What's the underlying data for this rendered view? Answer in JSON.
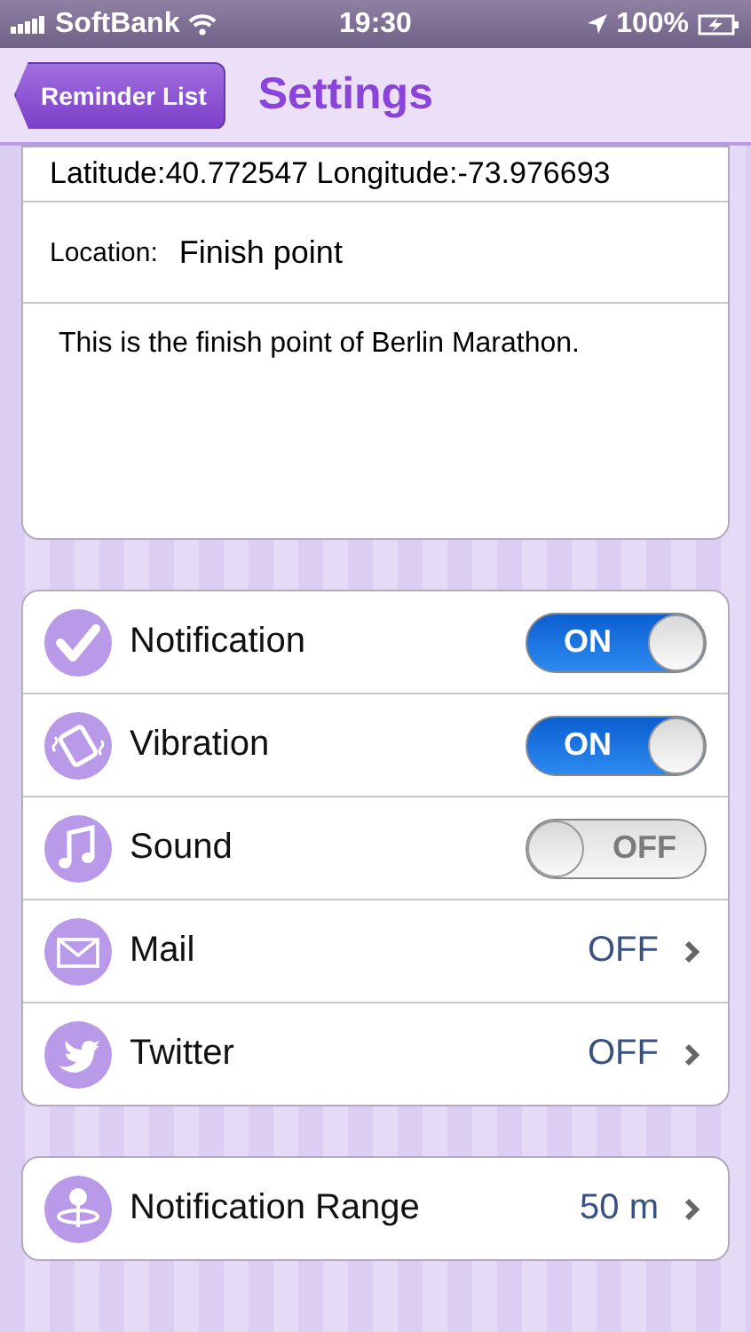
{
  "status_bar": {
    "carrier": "SoftBank",
    "time": "19:30",
    "battery": "100%"
  },
  "nav": {
    "back": "Reminder List",
    "title": "Settings"
  },
  "location_card": {
    "coordinates": "Latitude:40.772547 Longitude:-73.976693",
    "location_label": "Location:",
    "location_value": "Finish point",
    "note": "This is the finish point of Berlin Marathon."
  },
  "settings": [
    {
      "kind": "toggle",
      "label": "Notification",
      "on": true,
      "state_text": "ON"
    },
    {
      "kind": "toggle",
      "label": "Vibration",
      "on": true,
      "state_text": "ON"
    },
    {
      "kind": "toggle",
      "label": "Sound",
      "on": false,
      "state_text": "OFF"
    },
    {
      "kind": "link",
      "label": "Mail",
      "value": "OFF"
    },
    {
      "kind": "link",
      "label": "Twitter",
      "value": "OFF"
    }
  ],
  "range": {
    "label": "Notification Range",
    "value": "50 m"
  }
}
